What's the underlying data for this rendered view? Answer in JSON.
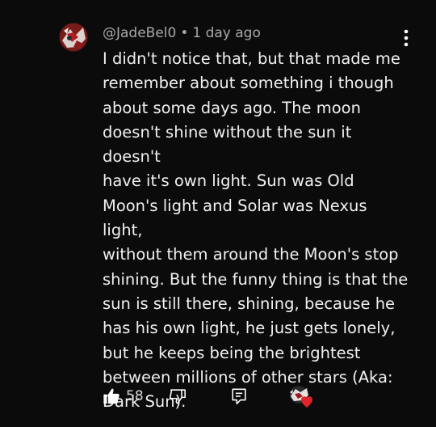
{
  "comment": {
    "author": "@JadeBel0",
    "separator": "•",
    "timestamp": "1 day ago",
    "text": "I didn't notice that, but that made me\nremember about something i though\nabout some days ago. The moon\ndoesn't shine without the sun it doesn't\nhave it's own light. Sun was Old\nMoon's light and Solar was Nexus light,\nwithout them around the Moon's stop\nshining. But the funny thing is that the\nsun is still there, shining, because he\nhas his own light, he just gets lonely,\nbut he keeps being the brightest\nbetween millions of other stars (Aka:\nDark Sun).",
    "like_count": "58"
  },
  "icons": {
    "avatar": "avatar",
    "more": "more-vert-icon",
    "like": "thumbs-up-icon",
    "dislike": "thumbs-down-icon",
    "reply": "reply-comment-icon",
    "hearted": "creator-heart-icon"
  },
  "colors": {
    "background": "#0b0b0b",
    "text": "#f1f1f1",
    "meta": "#a9a9a9",
    "heart": "#e0242b"
  }
}
